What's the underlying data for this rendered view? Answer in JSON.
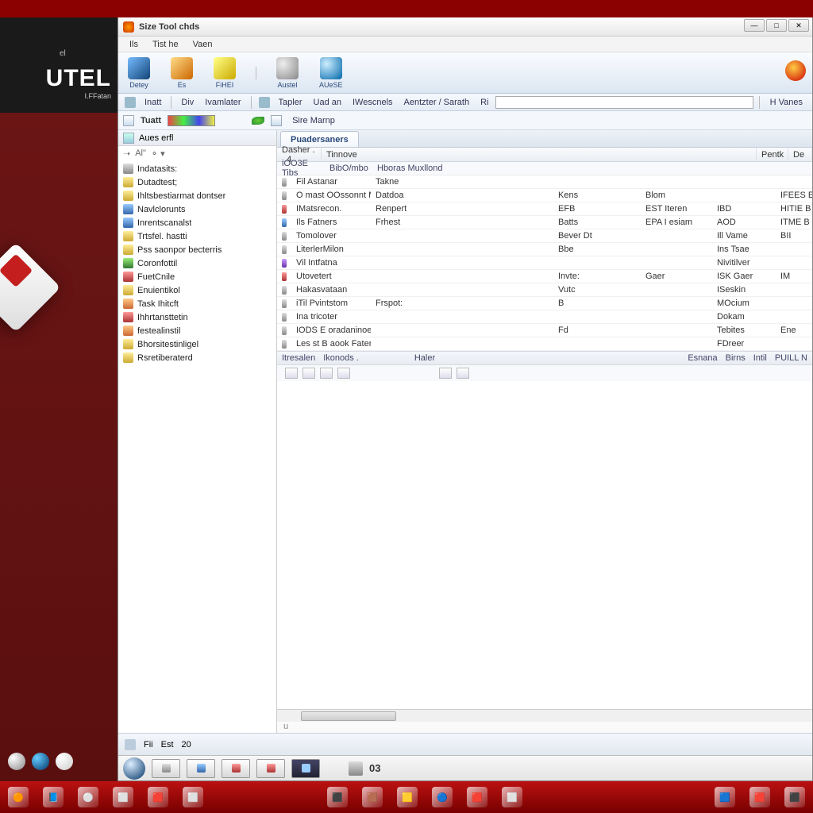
{
  "brand": {
    "name": "UTEL",
    "tag": "I.FFatan",
    "el": "el"
  },
  "window": {
    "title": "Size Tool chds"
  },
  "menus": [
    "Ils",
    "Tist he",
    "Vaen"
  ],
  "bigToolbar": [
    {
      "label": "Detey",
      "icon": "i-blue"
    },
    {
      "label": "Es",
      "icon": "i-orange"
    },
    {
      "label": "FiHEI",
      "icon": "i-yellow"
    },
    {
      "label": "Austel",
      "icon": "i-gray"
    },
    {
      "label": "AUeSE",
      "icon": "i-cyan"
    }
  ],
  "smallToolbar": {
    "items": [
      "Inatt",
      "Div",
      "Ivamlater",
      "Tapler",
      "Uad an",
      "IWescnels",
      "Aentzter / Sarath",
      "Ri"
    ],
    "right": "H Vanes"
  },
  "thirdBar": {
    "title": "Tuatt",
    "link": "Sire Marnp"
  },
  "tree": {
    "header": "Aues erfl",
    "sub": "Al\"",
    "items": [
      {
        "label": "Indatasits:",
        "icon": "c-gray"
      },
      {
        "label": "Dutadtest;",
        "icon": "c-fold"
      },
      {
        "label": "Ihltsbestiarmat dontser",
        "icon": "c-fold"
      },
      {
        "label": "Navlclorunts",
        "icon": "c-blue"
      },
      {
        "label": "Inrentscanalst",
        "icon": "c-blue"
      },
      {
        "label": "Trtsfel. hastti",
        "icon": "c-fold"
      },
      {
        "label": "Pss saonpor becterris",
        "icon": "c-fold"
      },
      {
        "label": "Coronfottil",
        "icon": "c-green"
      },
      {
        "label": "FuetCnile",
        "icon": "c-red"
      },
      {
        "label": "Enuientikol",
        "icon": "c-fold"
      },
      {
        "label": "Task Ihitcft",
        "icon": "c-orange"
      },
      {
        "label": "Ihhrtansttetin",
        "icon": "c-red"
      },
      {
        "label": "festealinstil",
        "icon": "c-orange"
      },
      {
        "label": "Bhorsitestinligel",
        "icon": "c-fold"
      },
      {
        "label": "Rsretiberaterd",
        "icon": "c-fold"
      }
    ]
  },
  "mainPanel": {
    "tab": "Puadersaners",
    "columns": [
      "Dasher . . 4",
      "Tinnove",
      "",
      "Pentk",
      "De"
    ],
    "subhead": [
      "iOO3E Tibs",
      "BibO/mbo",
      "Hboras Muxllond"
    ],
    "rows": [
      {
        "i": "c-gray",
        "name": "Fil Astanar",
        "type": "Takne",
        "a": "",
        "b": "",
        "c": "",
        "d": ""
      },
      {
        "i": "c-gray",
        "name": "O mast OOssonnt Mil",
        "type": "Datdoa",
        "a": "Kens",
        "b": "Blom",
        "c": "",
        "d": "IFEES E"
      },
      {
        "i": "c-red",
        "name": "IMatsrecon.",
        "type": "Renpert",
        "a": "EFB",
        "b": "EST Iteren",
        "c": "IBD",
        "d": "HITIE B"
      },
      {
        "i": "c-blue",
        "name": "Ils Fatners",
        "type": "Frhest",
        "a": "Batts",
        "b": "EPA I esiam",
        "c": "AOD",
        "d": "ITME B"
      },
      {
        "i": "c-gray",
        "name": "Tomolover",
        "type": "",
        "a": "Bever Dt",
        "b": "",
        "c": "Ill Vame",
        "d": "BII"
      },
      {
        "i": "c-gray",
        "name": "LiterlerMilon",
        "type": "",
        "a": "Bbe",
        "b": "",
        "c": "Ins Tsae",
        "d": ""
      },
      {
        "i": "c-purple",
        "name": "Vil Intfatna",
        "type": "",
        "a": "",
        "b": "",
        "c": "Nivitilver",
        "d": ""
      },
      {
        "i": "c-red",
        "name": "Utovetert",
        "type": "",
        "a": "Invte:",
        "b": "Gaer",
        "c": "ISK Gaer",
        "d": "IM"
      },
      {
        "i": "c-gray",
        "name": "Hakasvataan",
        "type": "",
        "a": "Vutc",
        "b": "",
        "c": "ISeskin",
        "d": ""
      },
      {
        "i": "c-gray",
        "name": "iTil Pvintstom",
        "type": "Frspot:",
        "a": "B",
        "b": "",
        "c": "MOcium",
        "d": ""
      },
      {
        "i": "c-gray",
        "name": "Ina tricoter",
        "type": "",
        "a": "",
        "b": "",
        "c": "Dokam",
        "d": ""
      },
      {
        "i": "c-gray",
        "name": "IODS E oradaninoes",
        "type": "",
        "a": "Fd",
        "b": "",
        "c": "Tebites",
        "d": "Ene"
      },
      {
        "i": "c-gray",
        "name": "Les st B aook Faters",
        "type": "",
        "a": "",
        "b": "",
        "c": "FDreer",
        "d": ""
      }
    ],
    "footer": [
      "Itresalen",
      "Ikonods .",
      "Haler",
      "Esnana",
      "Birns",
      "Intil",
      "PUILL N"
    ]
  },
  "statusBar": {
    "items": [
      "Fii",
      "Est",
      "20"
    ]
  },
  "appBar": {
    "num": "03"
  },
  "colors": {
    "accent": "#8b0000"
  }
}
